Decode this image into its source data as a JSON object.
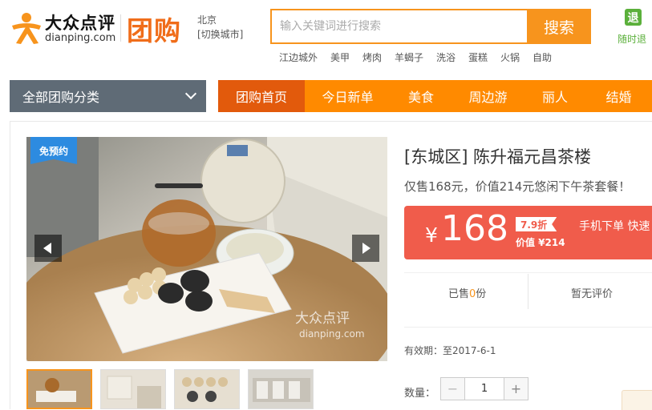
{
  "header": {
    "logo_cn": "大众点评",
    "logo_en": "dianping.com",
    "brand": "团购",
    "city": "北京",
    "city_switch": "[切换城市]",
    "search_placeholder": "输入关键词进行搜索",
    "search_button": "搜索",
    "hot_keywords": [
      "江边城外",
      "美甲",
      "烤肉",
      "羊蝎子",
      "洗浴",
      "蛋糕",
      "火锅",
      "自助"
    ],
    "refund_icon_text": "退",
    "refund_label": "随时退"
  },
  "nav": {
    "category_label": "全部团购分类",
    "items": [
      "团购首页",
      "今日新单",
      "美食",
      "周边游",
      "丽人",
      "结婚"
    ]
  },
  "gallery": {
    "badge": "免预约",
    "watermark_cn": "大众点评",
    "watermark_en": "dianping.com",
    "thumbnail_count": 4,
    "selected_thumbnail": 1
  },
  "deal": {
    "title": "[东城区] 陈升福元昌茶楼",
    "subtitle": "仅售168元，价值214元悠闲下午茶套餐！",
    "currency": "¥",
    "price": "168",
    "discount": "7.9折",
    "original_price": "价值 ¥214",
    "mobile_order": "手机下单 快速",
    "sold_prefix": "已售",
    "sold_count": "0",
    "sold_suffix": "份",
    "reviews": "暂无评价",
    "validity": "有效期：至2017-6-1",
    "quantity_label": "数量：",
    "quantity": "1",
    "minus": "−",
    "plus": "+"
  },
  "colors": {
    "brand_orange": "#f7941d",
    "nav_orange": "#ff8a00",
    "nav_active": "#e25a0c",
    "price_red": "#f05c4b",
    "category_gray": "#5f6b76",
    "badge_blue": "#2d8be0",
    "refund_green": "#5bb03b"
  }
}
